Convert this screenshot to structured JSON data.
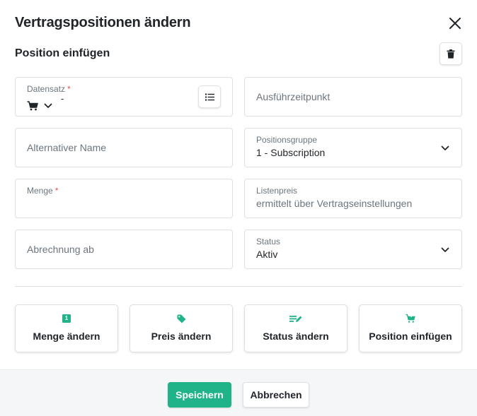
{
  "dialog": {
    "title": "Vertragspositionen ändern",
    "subtitle": "Position einfügen"
  },
  "fields": {
    "datensatz": {
      "label": "Datensatz",
      "required_mark": "*",
      "value": "-"
    },
    "ausfuehrzeitpunkt": {
      "placeholder": "Ausführzeitpunkt"
    },
    "alternativer_name": {
      "placeholder": "Alternativer Name"
    },
    "positionsgruppe": {
      "label": "Positionsgruppe",
      "value": "1 - Subscription"
    },
    "menge": {
      "label": "Menge",
      "required_mark": "*",
      "value": ""
    },
    "listenpreis": {
      "label": "Listenpreis",
      "value": "ermittelt über Vertragseinstellungen"
    },
    "abrechnung_ab": {
      "placeholder": "Abrechnung ab"
    },
    "status": {
      "label": "Status",
      "value": "Aktiv"
    }
  },
  "actions": [
    {
      "label": "Menge ändern",
      "icon": "number-one-box-icon",
      "badge": "1"
    },
    {
      "label": "Preis ändern",
      "icon": "price-tag-icon"
    },
    {
      "label": "Status ändern",
      "icon": "edit-status-icon"
    },
    {
      "label": "Position einfügen",
      "icon": "cart-plus-icon"
    }
  ],
  "footer": {
    "save_label": "Speichern",
    "cancel_label": "Abbrechen"
  },
  "colors": {
    "accent": "#20b38a",
    "required": "#e5534b",
    "text": "#212529",
    "muted": "#6c757d",
    "border": "#dcdfe3"
  }
}
